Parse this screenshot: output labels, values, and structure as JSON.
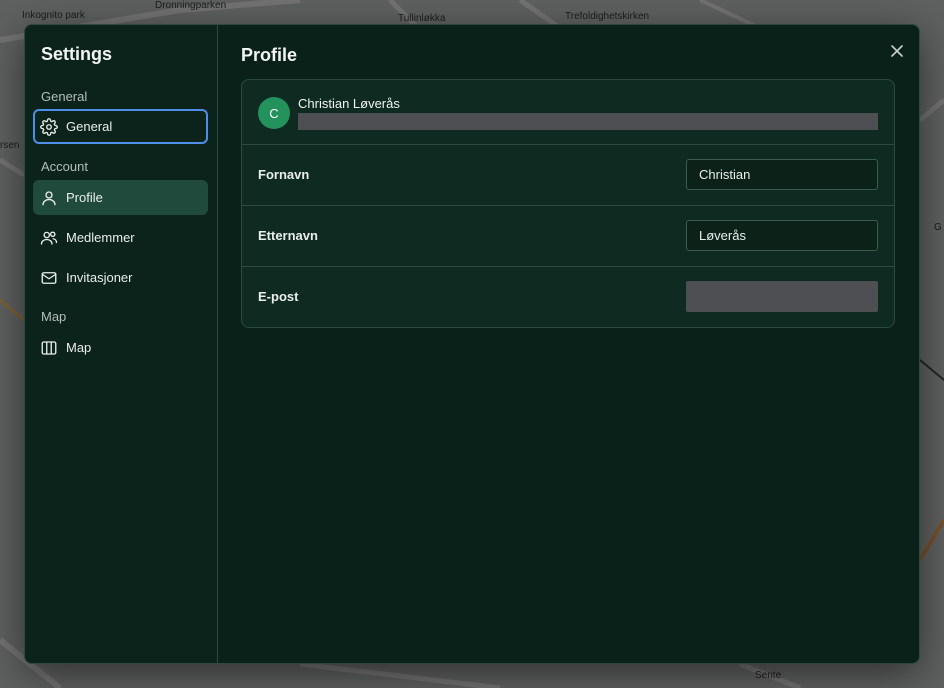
{
  "map": {
    "labels": [
      "Inkognito park",
      "Dronningparken",
      "Tullinløkka",
      "Trefoldighetskirken",
      "Sente",
      "rsen",
      "G"
    ]
  },
  "sidebar": {
    "title": "Settings",
    "sections": [
      {
        "label": "General",
        "items": [
          {
            "label": "General",
            "icon": "gear-icon"
          }
        ]
      },
      {
        "label": "Account",
        "items": [
          {
            "label": "Profile",
            "icon": "user-icon"
          },
          {
            "label": "Medlemmer",
            "icon": "users-icon"
          },
          {
            "label": "Invitasjoner",
            "icon": "mail-icon"
          }
        ]
      },
      {
        "label": "Map",
        "items": [
          {
            "label": "Map",
            "icon": "map-icon"
          }
        ]
      }
    ]
  },
  "main": {
    "title": "Profile",
    "close_icon": "close-icon",
    "profile": {
      "avatar_initial": "C",
      "avatar_color": "#23925c",
      "name": "Christian Løverås"
    },
    "fields": {
      "first_name": {
        "label": "Fornavn",
        "value": "Christian"
      },
      "last_name": {
        "label": "Etternavn",
        "value": "Løverås"
      },
      "email": {
        "label": "E-post"
      }
    }
  },
  "colors": {
    "modal_bg": "#0a2119",
    "active_item_bg": "#1f4a3c",
    "focus_ring": "#4d8ee8",
    "border": "#2c4a40"
  }
}
